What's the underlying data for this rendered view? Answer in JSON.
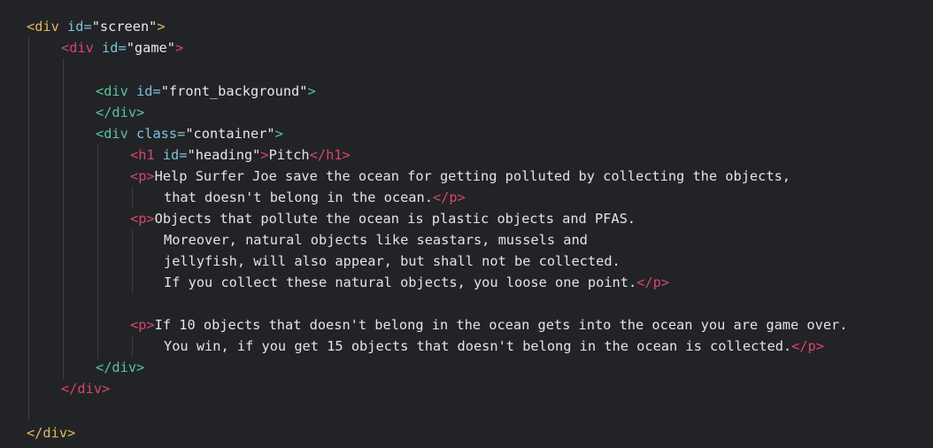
{
  "colors": {
    "background": "#222326",
    "tag_outer": "#e3b663",
    "tag_pink": "#d9456d",
    "tag_green": "#58c49a",
    "attribute": "#7bc4de",
    "text": "#e4e4e4",
    "indent_guide": "#3e3f44"
  },
  "code": {
    "l1": {
      "open": "<div",
      "attr": " id=",
      "val": "\"screen\"",
      "close": ">"
    },
    "l2": {
      "open": "<div",
      "attr": " id=",
      "val": "\"game\"",
      "close": ">"
    },
    "l4": {
      "open": "<div",
      "attr": " id=",
      "val": "\"front_background\"",
      "close": ">"
    },
    "l5": {
      "tag": "</div>"
    },
    "l6": {
      "open": "<div",
      "attr": " class=",
      "val": "\"container\"",
      "close": ">"
    },
    "l7": {
      "open": "<h1",
      "attr": " id=",
      "val": "\"heading\"",
      "close": ">",
      "text": "Pitch",
      "end": "</h1>"
    },
    "l8": {
      "open": "<p>",
      "text": "Help Surfer Joe save the ocean for getting polluted by collecting the objects,"
    },
    "l9": {
      "text": "that doesn't belong in the ocean.",
      "end": "</p>"
    },
    "l10": {
      "open": "<p>",
      "text": "Objects that pollute the ocean is plastic objects and PFAS."
    },
    "l11": {
      "text": "Moreover, natural objects like seastars, mussels and"
    },
    "l12": {
      "text": "jellyfish, will also appear, but shall not be collected."
    },
    "l13": {
      "text": "If you collect these natural objects, you loose one point.",
      "end": "</p>"
    },
    "l15": {
      "open": "<p>",
      "text": "If 10 objects that doesn't belong in the ocean gets into the ocean you are game over."
    },
    "l16": {
      "text": "You win, if you get 15 objects that doesn't belong in the ocean is collected.",
      "end": "</p>"
    },
    "l17": {
      "tag": "</div>"
    },
    "l18": {
      "tag": "</div>"
    },
    "l20": {
      "tag": "</div>"
    }
  }
}
